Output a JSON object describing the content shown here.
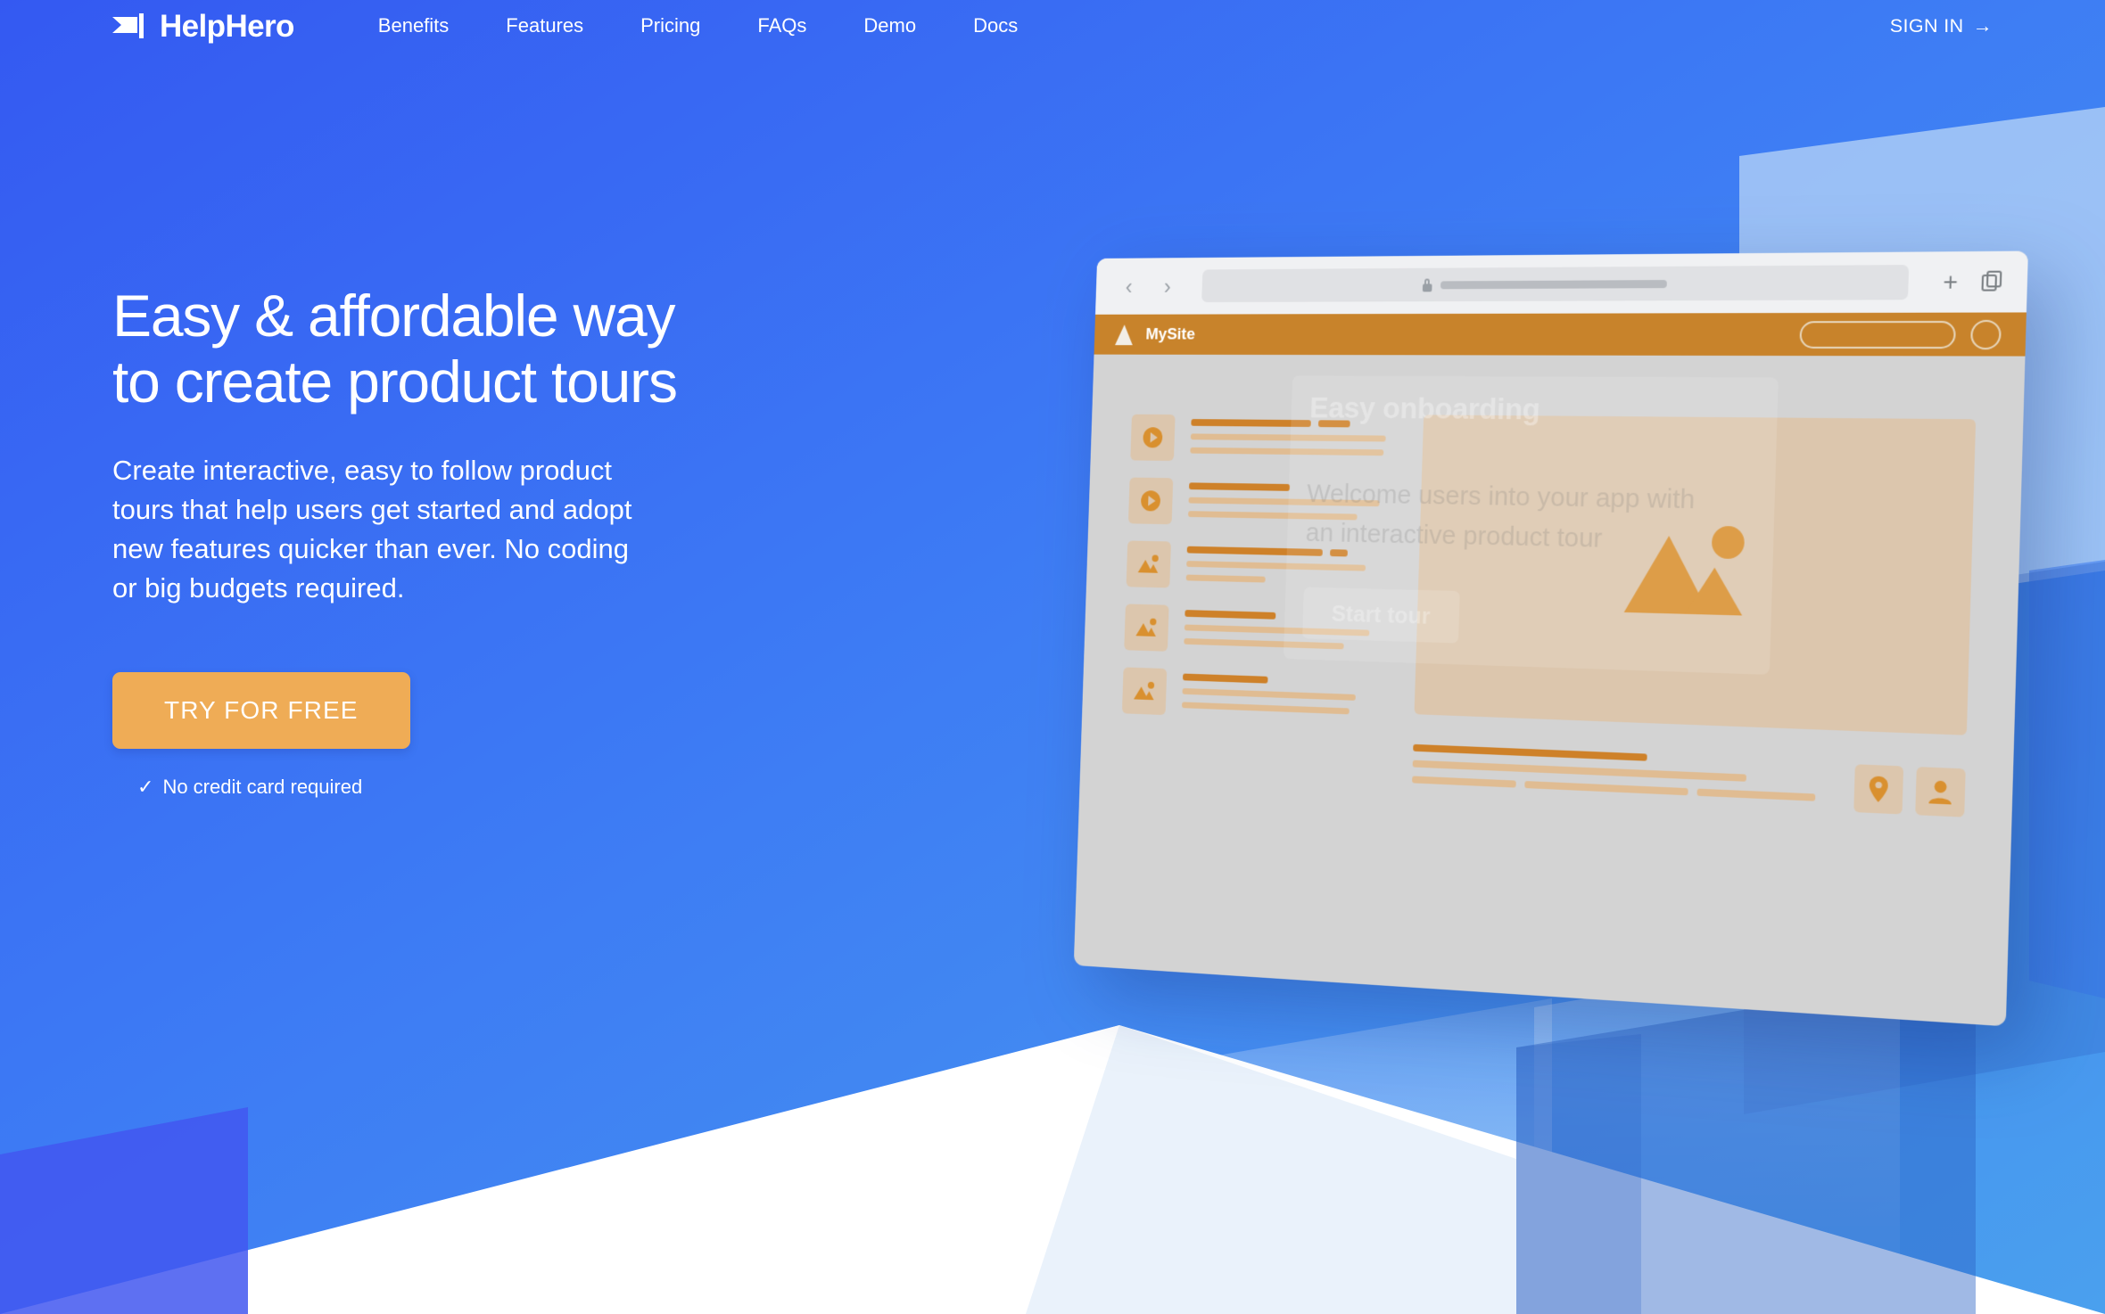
{
  "brand": {
    "name": "HelpHero",
    "logo_icon": "flag-icon"
  },
  "nav": {
    "items": [
      {
        "label": "Benefits"
      },
      {
        "label": "Features"
      },
      {
        "label": "Pricing"
      },
      {
        "label": "FAQs"
      },
      {
        "label": "Demo"
      },
      {
        "label": "Docs"
      }
    ],
    "signin_label": "SIGN IN",
    "signin_arrow": "→"
  },
  "hero": {
    "headline": "Easy & affordable way\nto create product tours",
    "subtext": "Create interactive, easy to follow product\ntours that help users get started and adopt\nnew features quicker than ever. No coding\nor big budgets required.",
    "cta_label": "TRY FOR FREE",
    "no_card_tick": "✓",
    "no_card_label": "No credit card required"
  },
  "mockup": {
    "browser": {
      "back_icon": "‹",
      "forward_icon": "›",
      "lock_icon": "lock-icon",
      "new_tab_icon": "+",
      "tabs_icon": "copy-tabs-icon"
    },
    "site": {
      "brand_label": "MySite",
      "brand_icon": "triangle-logo-icon"
    },
    "tooltip": {
      "title": "Easy onboarding",
      "body": "Welcome users into your app with\nan interactive product tour",
      "button_label": "Start tour"
    },
    "list_items": [
      {
        "icon": "play-icon"
      },
      {
        "icon": "play-icon"
      },
      {
        "icon": "image-icon"
      },
      {
        "icon": "image-icon"
      },
      {
        "icon": "image-icon"
      }
    ],
    "footer_tiles": [
      {
        "icon": "location-pin-icon"
      },
      {
        "icon": "user-icon"
      }
    ],
    "hero_image_icon": "image-icon"
  },
  "colors": {
    "gradient_start": "#3459F2",
    "gradient_end": "#4AA0EE",
    "accent_orange": "#EFAC56",
    "site_orange": "#C8832B",
    "mock_bg": "#D3D3D3",
    "mock_tan": "#DCC6AD",
    "text_white": "#FFFFFF"
  }
}
